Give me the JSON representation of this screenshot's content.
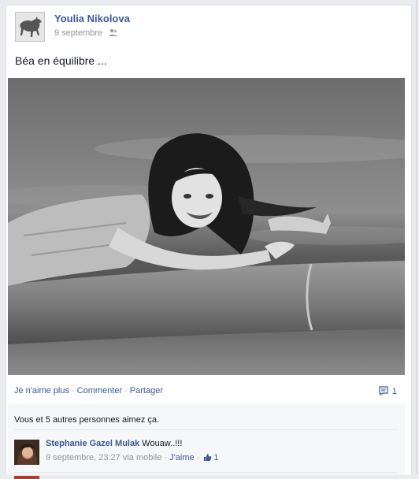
{
  "post": {
    "author": "Youlia Nikolova",
    "date": "9 septembre",
    "audience_icon": "friends-icon",
    "text": "Béa en équilibre ..."
  },
  "photo": {
    "kind": "black-and-white photo of a smiling girl with long hair leaning over a stone railing, arms outstretched",
    "tone": "grayscale"
  },
  "actions": {
    "unlike": "Je n'aime plus",
    "comment": "Commenter",
    "share": "Partager",
    "separator": "·",
    "comment_count": "1",
    "comment_icon": "comment-icon"
  },
  "likes": {
    "text": "Vous et 5 autres personnes aimez ça.",
    "link": "5 autres personnes"
  },
  "comments": [
    {
      "author": "Stephanie Gazel Mulak",
      "text": "Wouaw..!!!",
      "timestamp": "9 septembre, 23:27 via mobile",
      "like_label": "J'aime",
      "like_count": "1",
      "separator": "·"
    }
  ],
  "colors": {
    "link": "#3b5998",
    "meta": "#90949c",
    "ufi_background": "#f6f7f9",
    "page_background": "#e9ebee"
  }
}
